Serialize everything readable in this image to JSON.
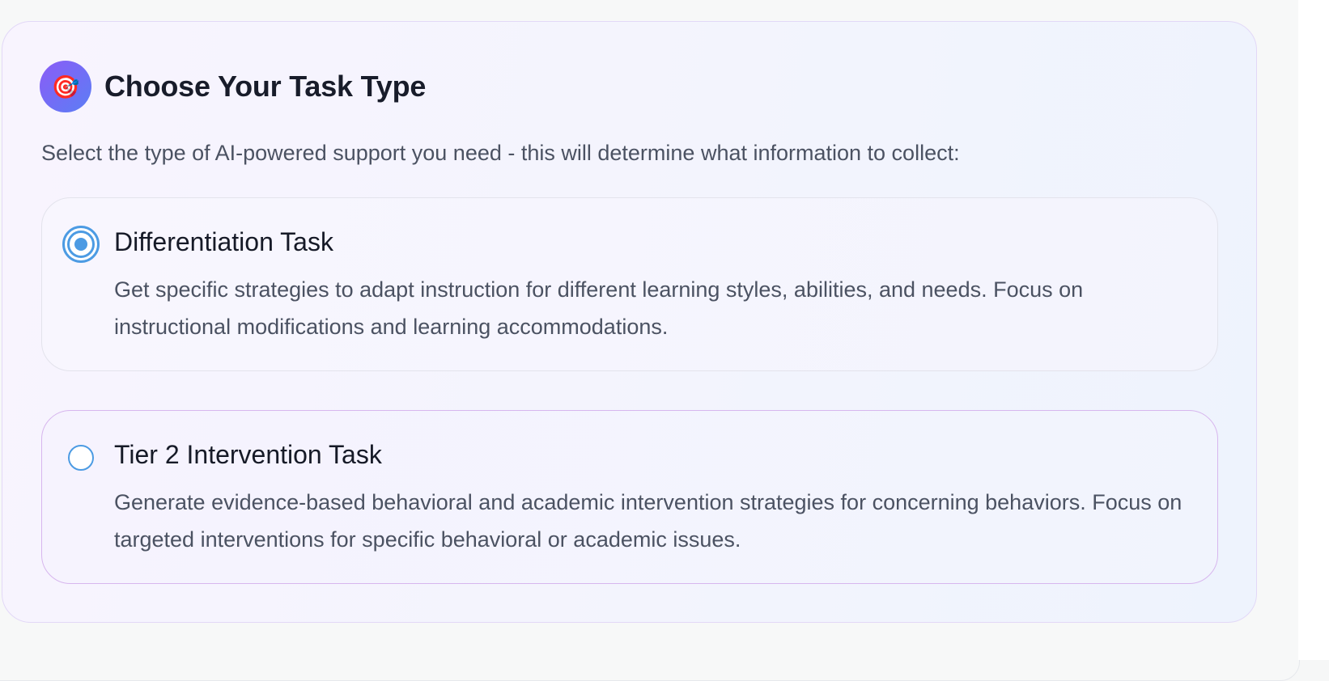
{
  "task_type": {
    "icon": "target-icon",
    "icon_glyph": "🎯",
    "title": "Choose Your Task Type",
    "intro": "Select the type of AI-powered support you need - this will determine what information to collect:",
    "options": [
      {
        "title": "Differentiation Task",
        "description": "Get specific strategies to adapt instruction for different learning styles, abilities, and needs. Focus on instructional modifications and learning accommodations.",
        "selected": true
      },
      {
        "title": "Tier 2 Intervention Task",
        "description": "Generate evidence-based behavioral and academic intervention strategies for concerning behaviors. Focus on targeted interventions for specific behavioral or academic issues.",
        "selected": false
      }
    ]
  },
  "colors": {
    "accent": "#4c9be3",
    "badge_start": "#8b5cf6",
    "badge_end": "#5b7ef5",
    "hover_border": "#d7b6ee"
  }
}
